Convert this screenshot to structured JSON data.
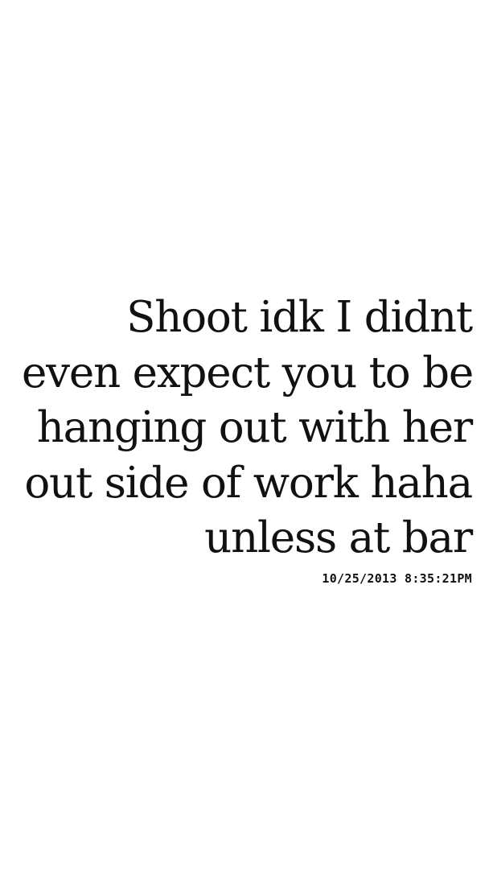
{
  "message": {
    "lines": [
      "Shoot idk I didnt",
      "even expect you to be",
      "hanging out with her",
      "out side of work haha",
      "unless at bar"
    ],
    "timestamp": "10/25/2013 8:35:21PM"
  }
}
